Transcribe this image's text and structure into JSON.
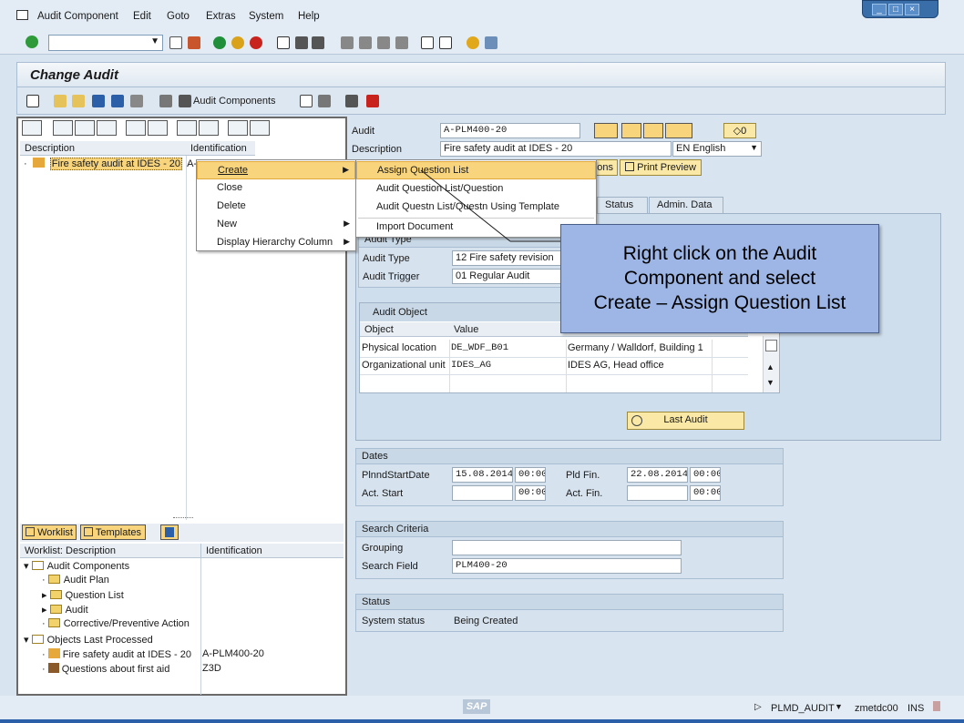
{
  "menubar": {
    "items": [
      "Audit Component",
      "Edit",
      "Goto",
      "Extras",
      "System",
      "Help"
    ]
  },
  "window_controls": [
    "minimize",
    "maximize",
    "close"
  ],
  "title": "Change Audit",
  "app_toolbar": {
    "audit_components_label": "Audit Components"
  },
  "left_tree": {
    "columns": [
      "Description",
      "Identification"
    ],
    "row": {
      "description": "Fire safety audit at IDES - 20",
      "identification": "A-"
    }
  },
  "context_menu": {
    "items": [
      {
        "label": "Create",
        "has_submenu": true,
        "selected": true
      },
      {
        "label": "Close",
        "has_submenu": false
      },
      {
        "label": "Delete",
        "has_submenu": false
      },
      {
        "label": "New",
        "has_submenu": true
      },
      {
        "label": "Display Hierarchy Column",
        "has_submenu": true
      }
    ]
  },
  "submenu": {
    "items": [
      {
        "label": "Assign Question List",
        "selected": true
      },
      {
        "label": "Audit Question List/Question"
      },
      {
        "label": "Audit Questn List/Questn Using Template"
      },
      {
        "label": "Import Document"
      }
    ]
  },
  "worklist": {
    "tabs": [
      "Worklist",
      "Templates"
    ],
    "columns": [
      "Worklist: Description",
      "Identification"
    ],
    "rows": [
      {
        "description": "Audit Components",
        "identification": "",
        "level": 0
      },
      {
        "description": "Audit Plan",
        "identification": "",
        "level": 1
      },
      {
        "description": "Question List",
        "identification": "",
        "level": 1
      },
      {
        "description": "Audit",
        "identification": "",
        "level": 1
      },
      {
        "description": "Corrective/Preventive Action",
        "identification": "",
        "level": 1
      },
      {
        "description": "Objects Last Processed",
        "identification": "",
        "level": 0
      },
      {
        "description": "Fire safety audit at IDES - 20",
        "identification": "A-PLM400-20",
        "level": 1
      },
      {
        "description": "Questions about first aid",
        "identification": "Z3D",
        "level": 1
      }
    ]
  },
  "audit_header": {
    "audit_label": "Audit",
    "audit_value": "A-PLM400-20",
    "description_label": "Description",
    "description_value": "Fire safety audit at IDES - 20",
    "language_value": "EN English",
    "count_value": "0",
    "options_partial": "ons",
    "print_preview_label": "Print Preview"
  },
  "tabs": [
    "Status",
    "Admin. Data"
  ],
  "audit_type_section": {
    "title": "Audit Type",
    "audit_type_label": "Audit Type",
    "audit_type_value": "12 Fire safety revision",
    "audit_trigger_label": "Audit Trigger",
    "audit_trigger_value": "01 Regular Audit"
  },
  "audit_object": {
    "title": "Audit Object",
    "columns": [
      "Object",
      "Value"
    ],
    "rows": [
      {
        "object": "Physical location",
        "value": "DE_WDF_B01",
        "text": "Germany / Walldorf, Building 1"
      },
      {
        "object": "Organizational unit",
        "value": "IDES_AG",
        "text": "IDES AG, Head office"
      }
    ]
  },
  "last_audit_label": "Last Audit",
  "dates": {
    "title": "Dates",
    "planned_start_label": "PlnndStartDate",
    "planned_start_date": "15.08.2014",
    "planned_start_time": "00:00",
    "planned_finish_label": "Pld Fin.",
    "planned_finish_date": "22.08.2014",
    "planned_finish_time": "00:00",
    "actual_start_label": "Act. Start",
    "actual_start_time": "00:00",
    "actual_finish_label": "Act. Fin.",
    "actual_finish_time": "00:00"
  },
  "search_criteria": {
    "title": "Search Criteria",
    "grouping_label": "Grouping",
    "grouping_value": "",
    "search_field_label": "Search Field",
    "search_field_value": "PLM400-20"
  },
  "status_section": {
    "title": "Status",
    "system_status_label": "System status",
    "system_status_value": "Being Created"
  },
  "callout": {
    "text_line1": "Right click on the Audit",
    "text_line2": "Component and select",
    "text_line3": "Create – Assign Question List"
  },
  "statusbar": {
    "logo": "SAP",
    "transaction": "PLMD_AUDIT",
    "server": "zmetdc00",
    "mode": "INS"
  },
  "colors": {
    "selection": "#f8d57c",
    "callout": "#9db6e6",
    "background": "#d8e4f0"
  }
}
